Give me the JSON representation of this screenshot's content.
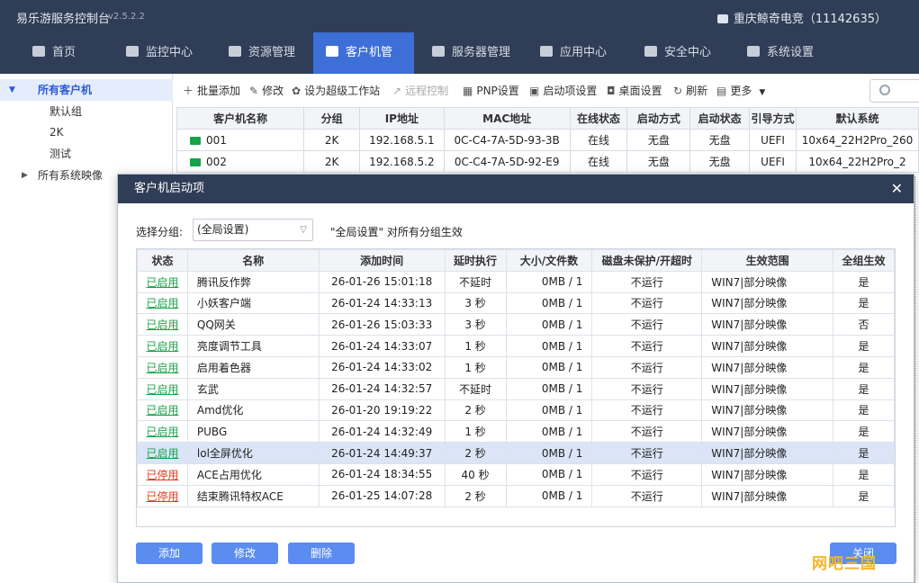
{
  "titlebar": {
    "app": "易乐游服务控制台",
    "version": "v2.5.2.2",
    "user": "重庆鲸奇电竞（11142635）"
  },
  "nav": [
    {
      "label": "首页"
    },
    {
      "label": "监控中心"
    },
    {
      "label": "资源管理"
    },
    {
      "label": "客户机管理"
    },
    {
      "label": "服务器管理"
    },
    {
      "label": "应用中心"
    },
    {
      "label": "安全中心"
    },
    {
      "label": "系统设置"
    }
  ],
  "sidebar": {
    "all_clients": "所有客户机",
    "groups": [
      "默认组",
      "2K",
      "测试"
    ],
    "all_images": "所有系统映像"
  },
  "toolbar": {
    "batch_add": "批量添加",
    "edit": "修改",
    "super_ws": "设为超级工作站",
    "remote": "远程控制",
    "pnp": "PNP设置",
    "startup": "启动项设置",
    "desktop": "桌面设置",
    "refresh": "刷新",
    "more": "更多"
  },
  "clients": {
    "headers": [
      "客户机名称",
      "分组",
      "IP地址",
      "MAC地址",
      "在线状态",
      "启动方式",
      "启动状态",
      "引导方式",
      "默认系统"
    ],
    "rows": [
      [
        "001",
        "2K",
        "192.168.5.1",
        "0C-C4-7A-5D-93-3B",
        "在线",
        "无盘",
        "无盘",
        "UEFI",
        "10x64_22H2Pro_260"
      ],
      [
        "002",
        "2K",
        "192.168.5.2",
        "0C-C4-7A-5D-92-E9",
        "在线",
        "无盘",
        "无盘",
        "UEFI",
        "10x64_22H2Pro_2"
      ]
    ]
  },
  "dialog": {
    "title": "客户机启动项",
    "group_label": "选择分组:",
    "group_value": "(全局设置)",
    "hint": "\"全局设置\" 对所有分组生效",
    "headers": [
      "状态",
      "名称",
      "添加时间",
      "延时执行",
      "大小/文件数",
      "磁盘未保护/开超时",
      "生效范围",
      "全组生效"
    ],
    "rows": [
      [
        "已启用",
        "腾讯反作弊",
        "26-01-26 15:01:18",
        "不延时",
        "0MB / 1",
        "不运行",
        "WIN7|部分映像",
        "是"
      ],
      [
        "已启用",
        "小妖客户端",
        "26-01-24 14:33:13",
        "3 秒",
        "0MB / 1",
        "不运行",
        "WIN7|部分映像",
        "是"
      ],
      [
        "已启用",
        "QQ网关",
        "26-01-26 15:03:33",
        "3 秒",
        "0MB / 1",
        "不运行",
        "WIN7|部分映像",
        "否"
      ],
      [
        "已启用",
        "亮度调节工具",
        "26-01-24 14:33:07",
        "1 秒",
        "0MB / 1",
        "不运行",
        "WIN7|部分映像",
        "是"
      ],
      [
        "已启用",
        "启用着色器",
        "26-01-24 14:33:02",
        "1 秒",
        "0MB / 1",
        "不运行",
        "WIN7|部分映像",
        "是"
      ],
      [
        "已启用",
        "玄武",
        "26-01-24 14:32:57",
        "不延时",
        "0MB / 1",
        "不运行",
        "WIN7|部分映像",
        "是"
      ],
      [
        "已启用",
        "Amd优化",
        "26-01-20 19:19:22",
        "2 秒",
        "0MB / 1",
        "不运行",
        "WIN7|部分映像",
        "是"
      ],
      [
        "已启用",
        "PUBG",
        "26-01-24 14:32:49",
        "1 秒",
        "0MB / 1",
        "不运行",
        "WIN7|部分映像",
        "是"
      ],
      [
        "已启用",
        "lol全屏优化",
        "26-01-24 14:49:37",
        "2 秒",
        "0MB / 1",
        "不运行",
        "WIN7|部分映像",
        "是"
      ],
      [
        "已停用",
        "ACE占用优化",
        "26-01-24 18:34:55",
        "40 秒",
        "0MB / 1",
        "不运行",
        "WIN7|部分映像",
        "是"
      ],
      [
        "已停用",
        "结束腾讯特权ACE",
        "26-01-25 14:07:28",
        "2 秒",
        "0MB / 1",
        "不运行",
        "WIN7|部分映像",
        "是"
      ]
    ],
    "buttons": {
      "add": "添加",
      "edit": "修改",
      "delete": "删除",
      "close": "关闭"
    }
  },
  "watermark": "网吧三国"
}
